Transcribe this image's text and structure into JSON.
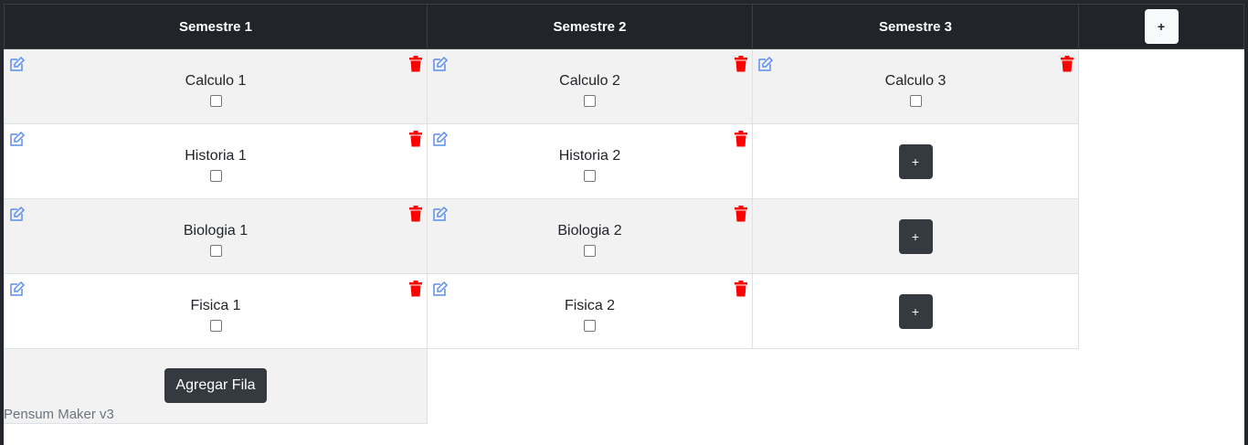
{
  "header": {
    "columns": [
      "Semestre 1",
      "Semestre 2",
      "Semestre 3"
    ],
    "add_column_label": "+"
  },
  "rows": [
    {
      "cells": [
        "Calculo 1",
        "Calculo 2",
        "Calculo 3"
      ]
    },
    {
      "cells": [
        "Historia 1",
        "Historia 2"
      ],
      "add_label": "+"
    },
    {
      "cells": [
        "Biologia 1",
        "Biologia 2"
      ],
      "add_label": "+"
    },
    {
      "cells": [
        "Fisica 1",
        "Fisica 2"
      ],
      "add_label": "+"
    }
  ],
  "add_row_label": "Agregar Fila",
  "footer": "Pensum Maker v3",
  "colors": {
    "header_bg": "#212529",
    "edit_icon": "#5b8def",
    "trash_icon": "#ff0000",
    "button_dark": "#343a40",
    "stripe": "#f2f2f2"
  },
  "icons": {
    "edit": "edit-icon",
    "trash": "trash-icon"
  }
}
